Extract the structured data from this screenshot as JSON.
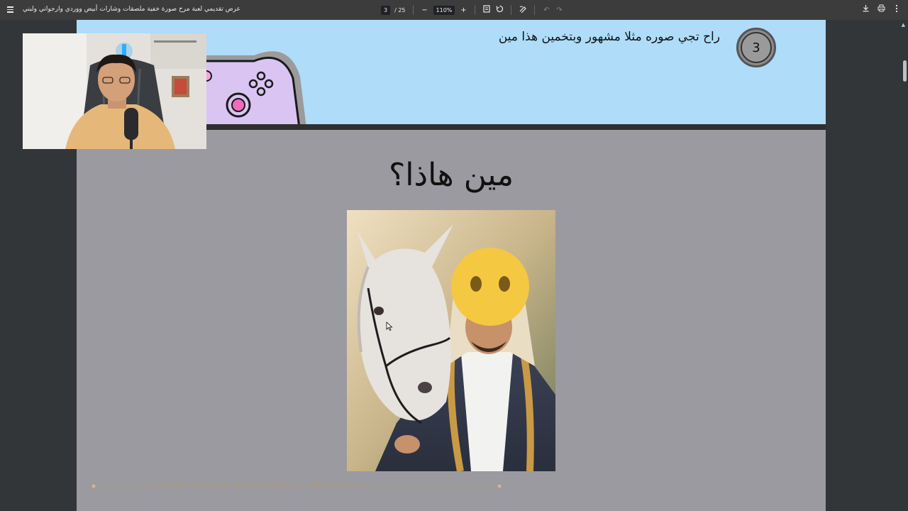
{
  "toolbar": {
    "title": "عرض تقديمي لعبة مرح صورة خفية ملصقات وشارات أبيض ووردي وارجواني ولبني",
    "page_current": "3",
    "page_total": "/ 25",
    "zoom": "110%",
    "zoom_out": "−",
    "zoom_in": "+"
  },
  "slide1": {
    "step_number": "3",
    "text": "راح تجي صوره مثلا مشهور وبتخمين هذا مين"
  },
  "slide2": {
    "heading": "مين هاذا؟",
    "footer_handles": [
      "IMUATHSA",
      "IMUATHSA",
      "IMUATHSA"
    ]
  },
  "colors": {
    "slide1_bg": "#aedcf9",
    "slide2_bg": "#9a9aa0",
    "toolbar_bg": "#3c3c3c",
    "viewer_bg": "#323639",
    "emoji_yellow": "#f5c842"
  },
  "icons": [
    "menu-icon",
    "fit-page-icon",
    "rotate-icon",
    "annotate-icon",
    "undo-icon",
    "redo-icon",
    "download-icon",
    "print-icon",
    "more-icon",
    "gamepad-icon",
    "x-icon",
    "instagram-icon",
    "tiktok-icon"
  ]
}
